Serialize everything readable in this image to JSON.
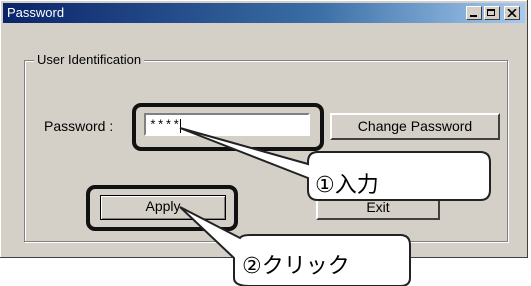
{
  "window": {
    "title": "Password"
  },
  "titlebar_buttons": {
    "minimize": "minimize-icon",
    "maximize": "maximize-icon",
    "close": "close-icon"
  },
  "group": {
    "label": "User Identification"
  },
  "password": {
    "label": "Password :",
    "value": "****"
  },
  "buttons": {
    "change_password": "Change Password",
    "apply": "Apply",
    "exit": "Exit"
  },
  "callouts": {
    "input": "①入力",
    "click": "②クリック"
  },
  "colors": {
    "titlebar_start": "#0a246a",
    "titlebar_end": "#a6caf0",
    "window_bg": "#d4d0c8"
  }
}
